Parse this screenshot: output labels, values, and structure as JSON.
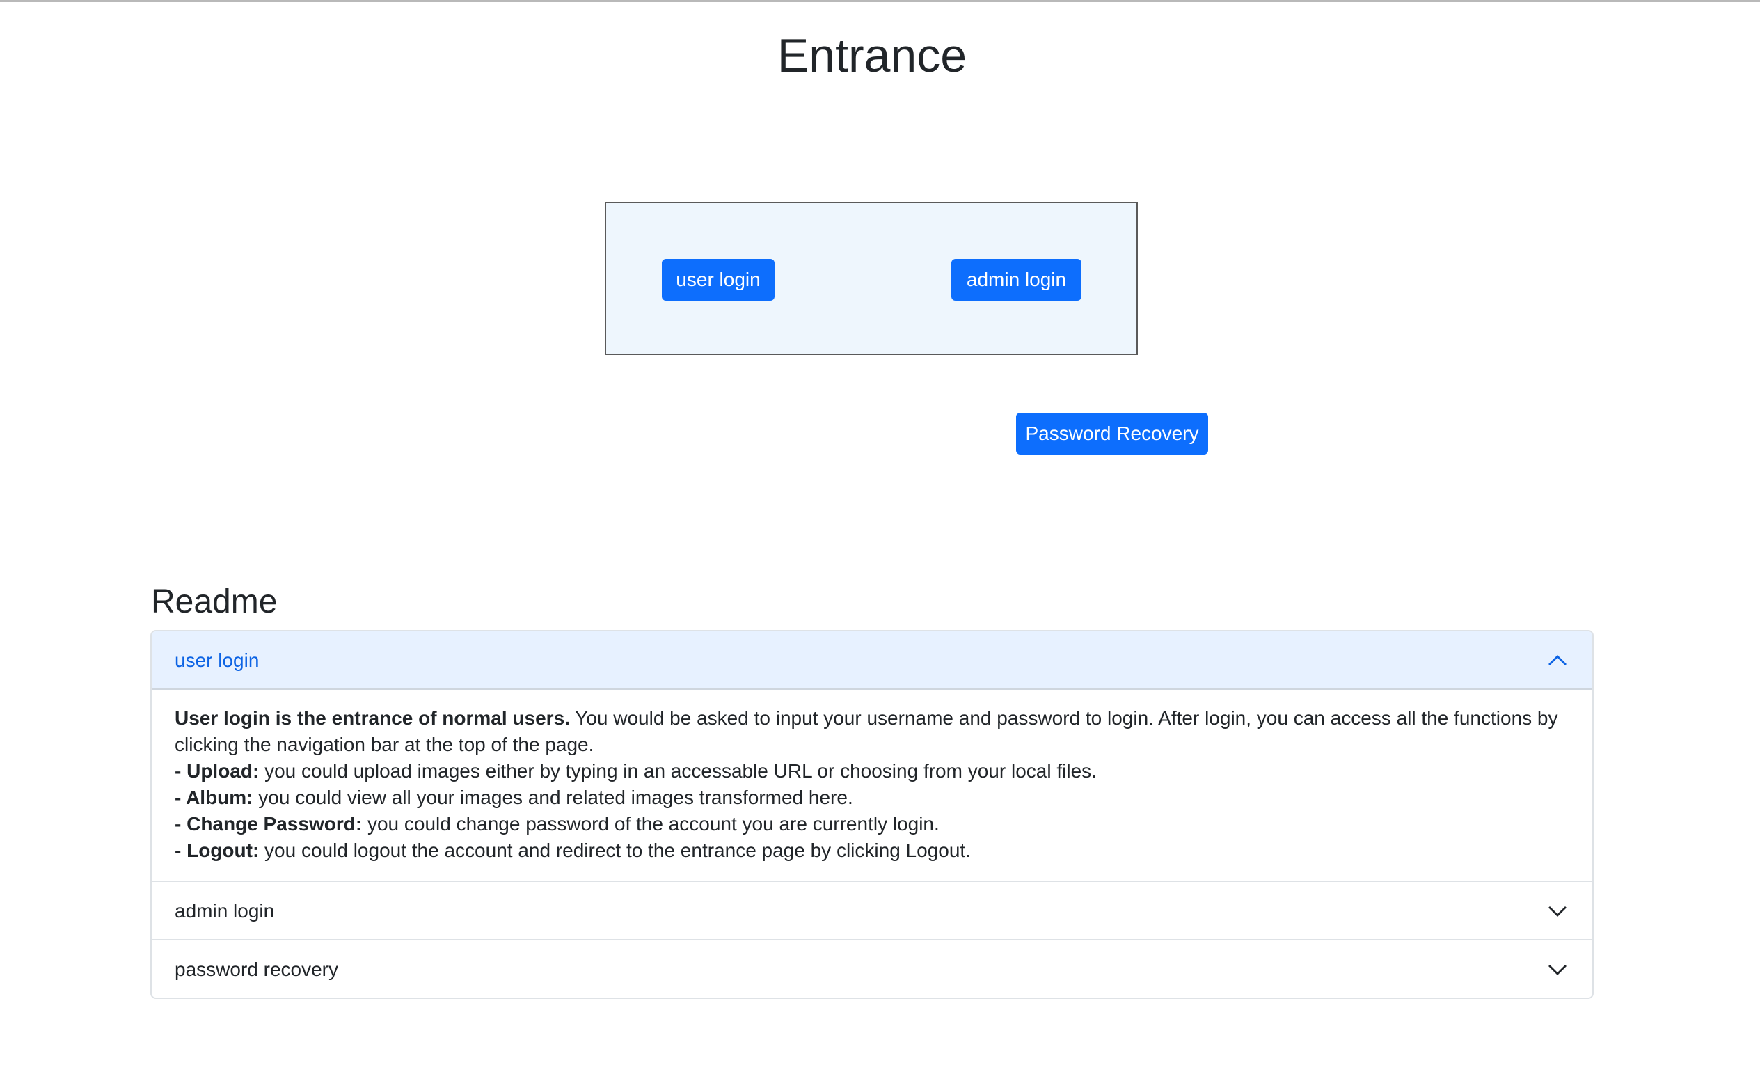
{
  "page": {
    "title": "Entrance"
  },
  "login_box": {
    "user_login_label": "user login",
    "admin_login_label": "admin login"
  },
  "password_recovery_label": "Password Recovery",
  "readme": {
    "heading": "Readme",
    "sections": [
      {
        "title": "user login",
        "expanded": true,
        "intro_bold": "User login is the entrance of normal users.",
        "intro_rest": " You would be asked to input your username and password to login. After login, you can access all the functions by clicking the navigation bar at the top of the page.",
        "items": [
          {
            "label": "- Upload:",
            "text": " you could upload images either by typing in an accessable URL or choosing from your local files."
          },
          {
            "label": "- Album:",
            "text": " you could view all your images and related images transformed here."
          },
          {
            "label": "- Change Password:",
            "text": " you could change password of the account you are currently login."
          },
          {
            "label": "- Logout:",
            "text": " you could logout the account and redirect to the entrance page by clicking Logout."
          }
        ]
      },
      {
        "title": "admin login",
        "expanded": false
      },
      {
        "title": "password recovery",
        "expanded": false
      }
    ]
  },
  "icons": {
    "expanded": "chevron-up-icon",
    "collapsed": "chevron-down-icon"
  },
  "colors": {
    "primary": "#0d6efd",
    "login_box_bg": "#eef6fd",
    "accordion_active_bg": "#e7f1ff",
    "accordion_active_text": "#0c63e4"
  }
}
